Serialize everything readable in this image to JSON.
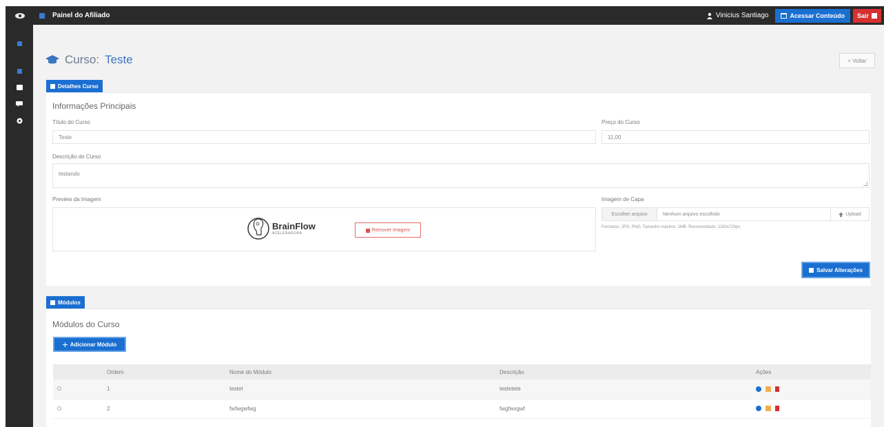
{
  "topbar": {
    "brand": "Painel do Afiliado",
    "user": "Vinicius Santiago",
    "external_btn": "Acessar Conteúdo",
    "exit_btn": "Sair"
  },
  "page": {
    "title_prefix": "Curso:",
    "title_name": "Teste",
    "back_label": "< Voltar"
  },
  "details": {
    "tab_label": "Detalhes Curso",
    "section_title": "Informações Principais",
    "name_label": "Título do Curso",
    "name_value": "Teste",
    "price_label": "Preço do Curso",
    "price_value": "11,00",
    "desc_label": "Descrição do Curso",
    "desc_value": "testando",
    "preview_label": "Preview da Imagem",
    "brand_name": "BrainFlow",
    "brand_tag": "ACELERADORA",
    "remove_btn": "Remover Imagem",
    "cover_label": "Imagem de Capa",
    "choose_btn": "Escolher arquivo",
    "no_file": "Nenhum arquivo escolhido",
    "upload_btn": "Upload",
    "hint": "Formatos: JPG, PNG. Tamanho máximo: 2MB. Recomendado: 1280x720px",
    "save_btn": "Salvar Alterações"
  },
  "modules": {
    "tab_label": "Módulos",
    "section_title": "Módulos do Curso",
    "add_btn": "Adicionar Módulo",
    "columns": [
      "",
      "Ordem",
      "Nome do Módulo",
      "Descrição",
      "Ações"
    ],
    "rows": [
      {
        "order": "1",
        "name": "testet",
        "desc": "testetete"
      },
      {
        "order": "2",
        "name": "fwfwgwfwg",
        "desc": "fwgfwvgwf"
      }
    ]
  },
  "colors": {
    "accent": "#1a6fd1",
    "danger": "#d63031",
    "dark": "#2a2a2a",
    "edit": "#f0ad4e"
  }
}
